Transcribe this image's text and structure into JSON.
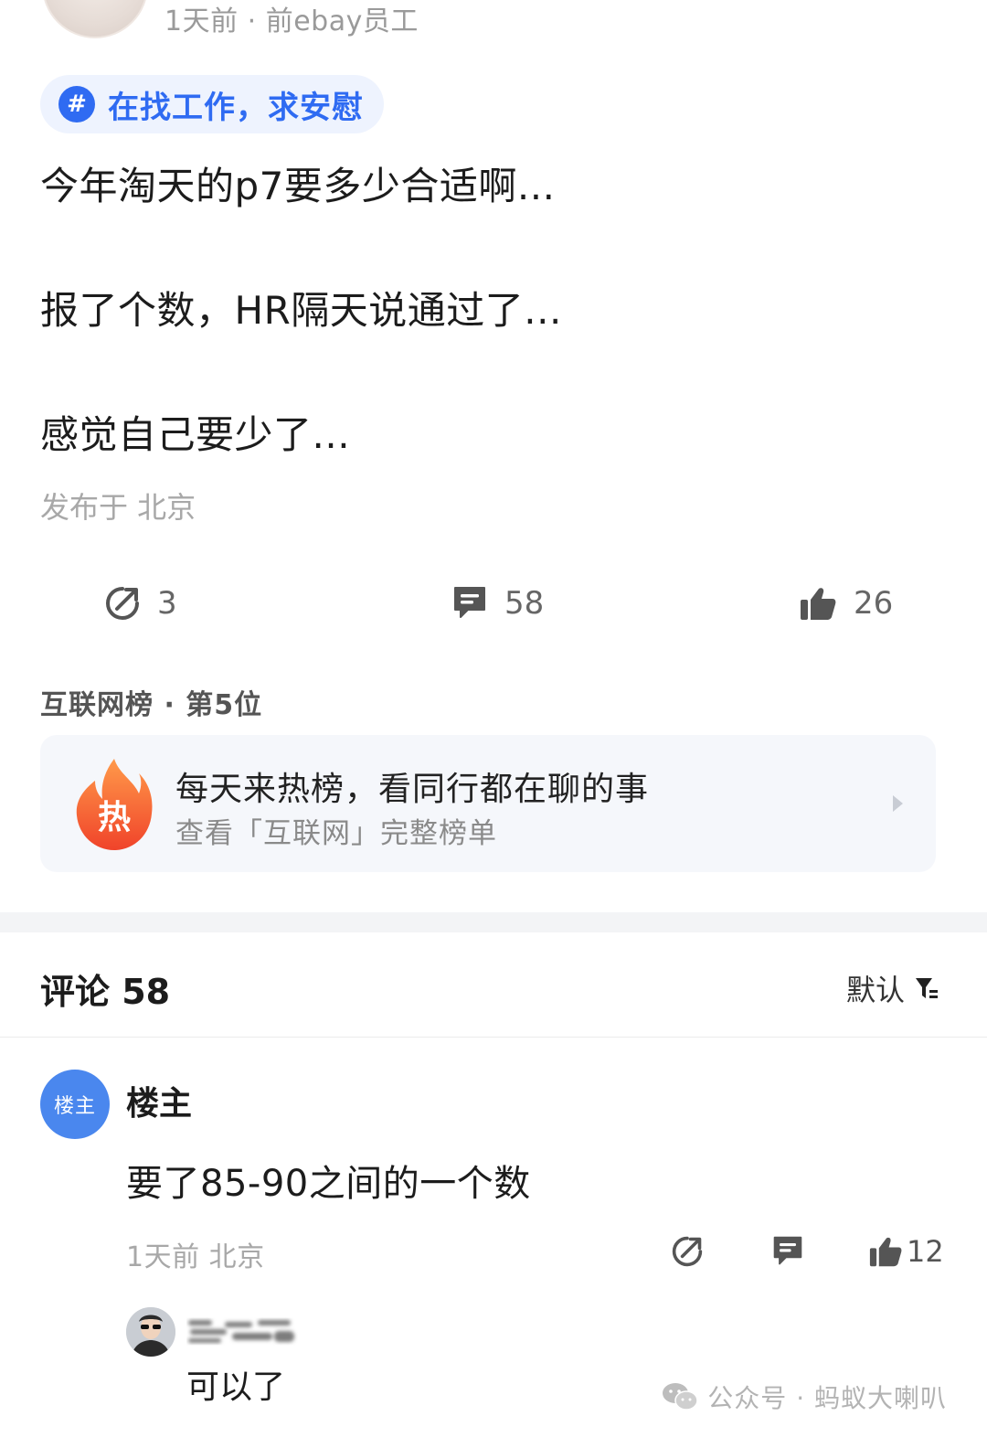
{
  "post": {
    "meta": "1天前 · 前ebay员工",
    "topic": "在找工作，求安慰",
    "topic_icon": "hash-icon",
    "lines": [
      "今年淘天的p7要多少合适啊...",
      "报了个数，HR隔天说通过了...",
      "感觉自己要少了..."
    ],
    "location": "发布于 北京",
    "actions": {
      "share_count": "3",
      "comment_count": "58",
      "like_count": "26"
    }
  },
  "ranking": {
    "title": "互联网榜 · 第5位",
    "card": {
      "badge": "热",
      "headline": "每天来热榜，看同行都在聊的事",
      "subline": "查看「互联网」完整榜单"
    }
  },
  "comments": {
    "title": "评论 58",
    "sort_label": "默认",
    "items": [
      {
        "avatar_label": "楼主",
        "name": "楼主",
        "text": "要了85-90之间的一个数",
        "meta": "1天前  北京",
        "like_count": "12",
        "replies": [
          {
            "text": "可以了"
          }
        ]
      }
    ]
  },
  "watermark": "公众号 · 蚂蚁大喇叭",
  "colors": {
    "accent": "#2f6bf2",
    "chip_bg": "#eef3fe",
    "card_bg": "#f5f7fb",
    "hot_gradient_top": "#ff8a3d",
    "hot_gradient_bottom": "#f24a2a"
  }
}
